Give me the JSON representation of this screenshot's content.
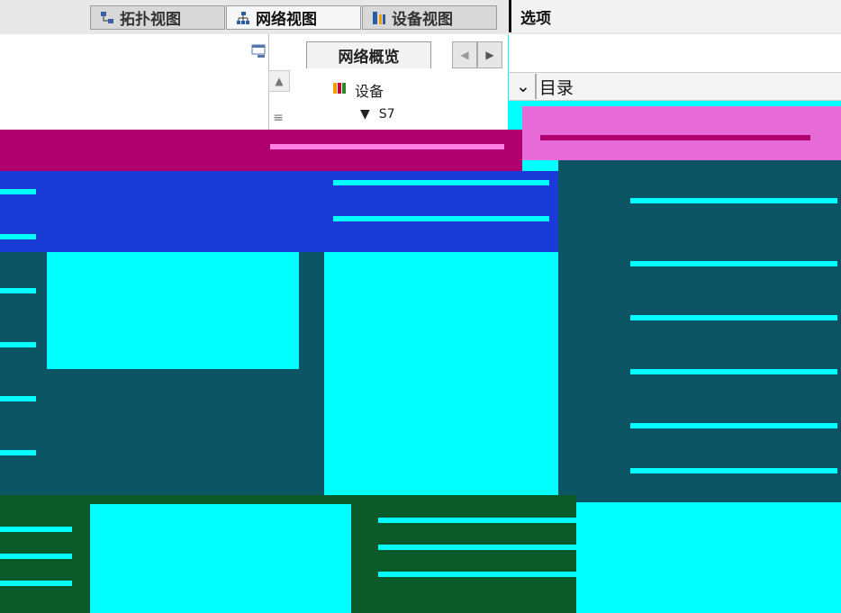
{
  "toolbar": {
    "tabs": [
      {
        "label": "拓扑视图",
        "icon": "topology-icon"
      },
      {
        "label": "网络视图",
        "icon": "network-icon"
      },
      {
        "label": "设备视图",
        "icon": "device-icon"
      }
    ]
  },
  "options": {
    "title": "选项",
    "catalog_label": "目录",
    "catalog_toggle_icon": "chevron-down-icon"
  },
  "network_overview": {
    "tab_label": "网络概览",
    "nav_prev_icon": "chevron-left-icon",
    "nav_next_icon": "chevron-right-icon",
    "devices_label": "设备",
    "devices_icon": "devices-icon",
    "tree_item_prefix": "S7"
  },
  "colors": {
    "magenta": "#b0006f",
    "cyan": "#00ffff",
    "blue": "#1b3bd6",
    "teal": "#0a5463",
    "green": "#0a5a2a"
  }
}
